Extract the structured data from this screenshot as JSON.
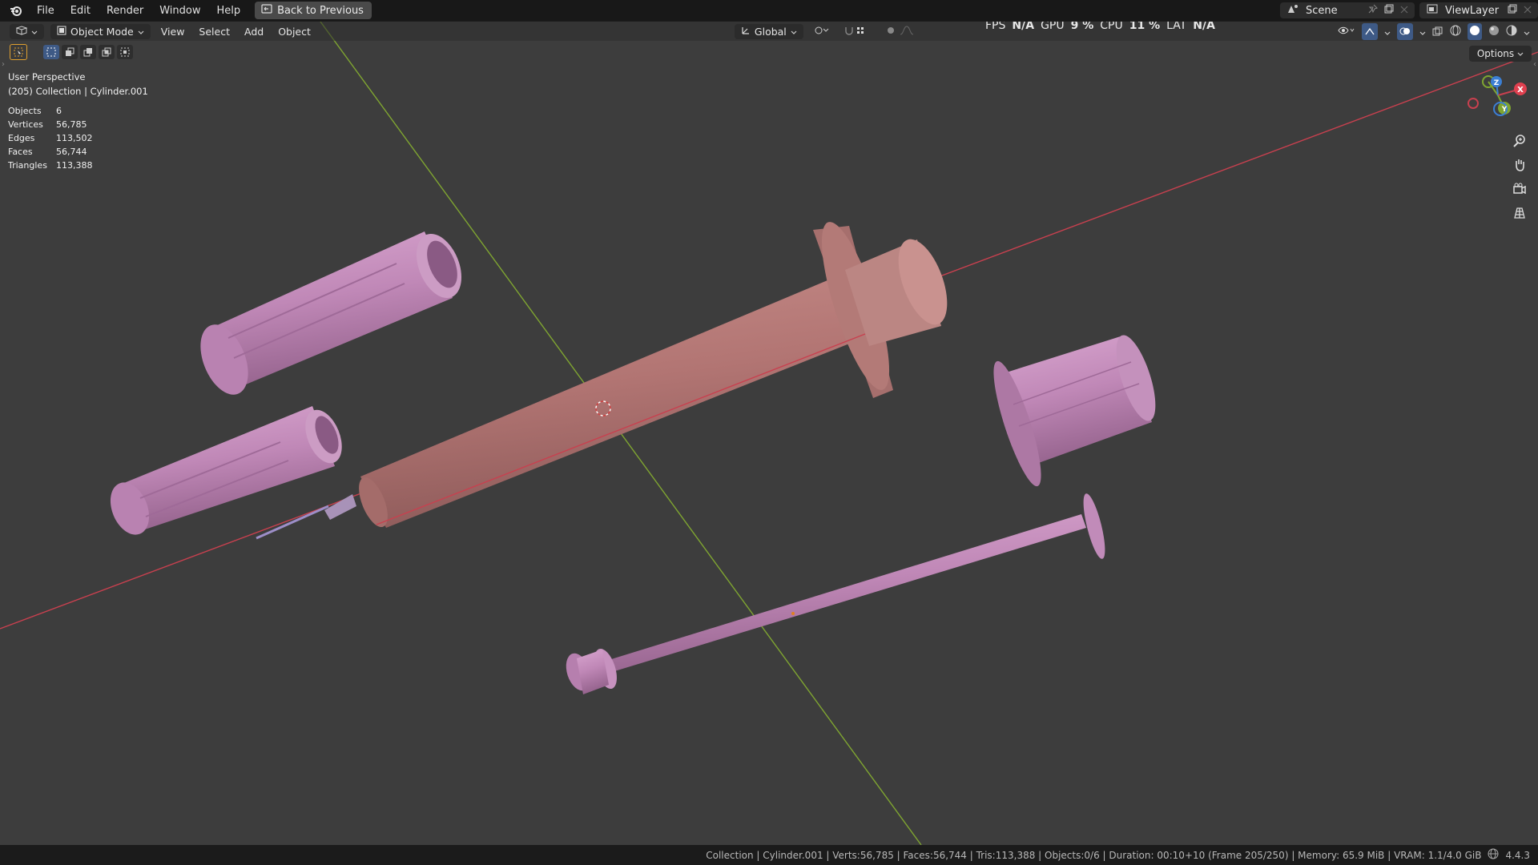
{
  "menu": {
    "file": "File",
    "edit": "Edit",
    "render": "Render",
    "window": "Window",
    "help": "Help",
    "back_button": "Back to Previous"
  },
  "top_right": {
    "scene": "Scene",
    "view_layer": "ViewLayer"
  },
  "viewport_header": {
    "mode": "Object Mode",
    "view": "View",
    "select": "Select",
    "add": "Add",
    "object": "Object",
    "transform_orientation": "Global",
    "options": "Options"
  },
  "perf": {
    "fps_label": "FPS",
    "fps_value": "N/A",
    "gpu_label": "GPU",
    "gpu_value": "9 %",
    "cpu_label": "CPU",
    "cpu_value": "11 %",
    "lat_label": "LAT",
    "lat_value": "N/A"
  },
  "overlay": {
    "perspective": "User Perspective",
    "context": "(205) Collection | Cylinder.001",
    "stats": [
      {
        "label": "Objects",
        "value": "6"
      },
      {
        "label": "Vertices",
        "value": "56,785"
      },
      {
        "label": "Edges",
        "value": "113,502"
      },
      {
        "label": "Faces",
        "value": "56,744"
      },
      {
        "label": "Triangles",
        "value": "113,388"
      }
    ]
  },
  "gizmo": {
    "x": "X",
    "y": "Y",
    "z": "Z"
  },
  "colors": {
    "viewport_bg": "#3d3d3d",
    "axis_x": "#c8404f",
    "axis_y": "#7fa531",
    "barrel": "#b87a78",
    "part": "#c88fbe"
  },
  "statusbar": {
    "text": "Collection | Cylinder.001 | Verts:56,785 | Faces:56,744 | Tris:113,388 | Objects:0/6 | Duration: 00:10+10 (Frame 205/250) | Memory: 65.9 MiB | VRAM: 1.1/4.0 GiB",
    "version": "4.4.3"
  }
}
